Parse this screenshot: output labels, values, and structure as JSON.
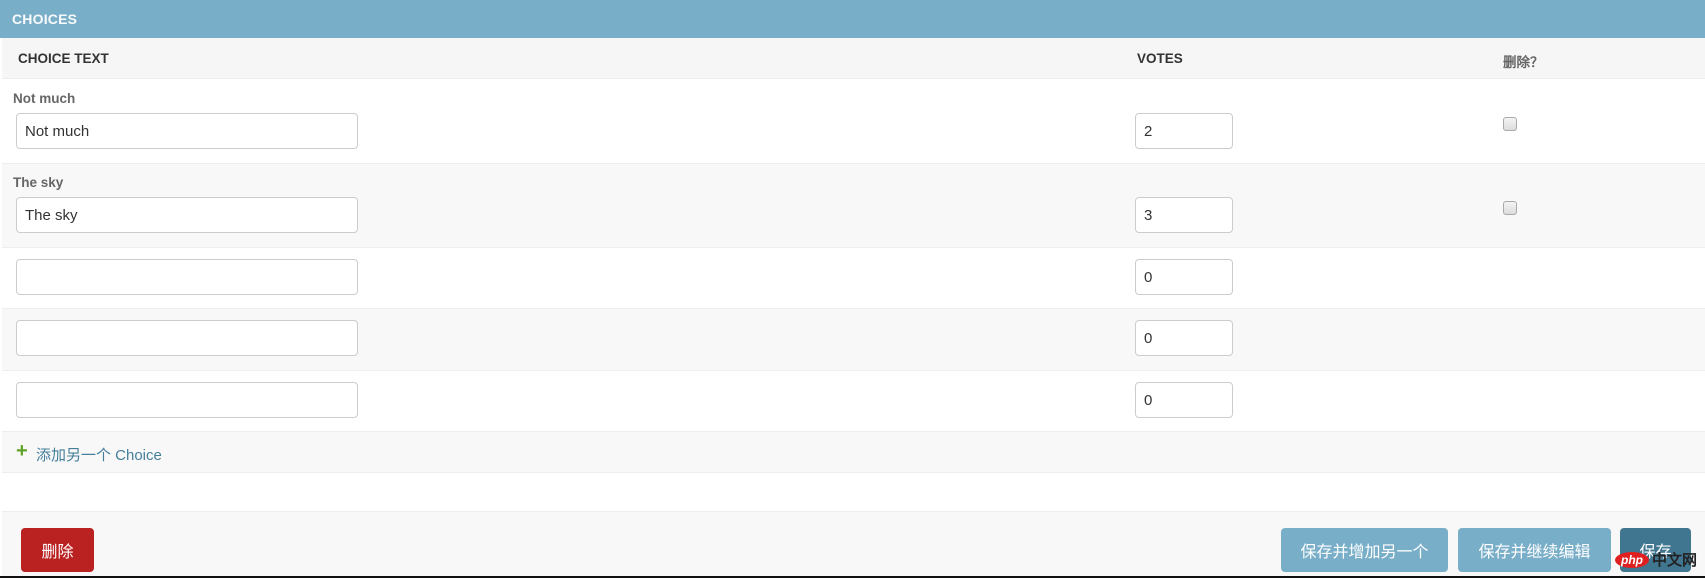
{
  "module": {
    "title": "CHOICES"
  },
  "columns": {
    "choice_text": "CHOICE TEXT",
    "votes": "VOTES",
    "delete": "删除？"
  },
  "rows": [
    {
      "label": "Not much",
      "choice_text": "Not much",
      "votes": "2",
      "deletable": true
    },
    {
      "label": "The sky",
      "choice_text": "The sky",
      "votes": "3",
      "deletable": true
    },
    {
      "label": "",
      "choice_text": "",
      "votes": "0",
      "deletable": false
    },
    {
      "label": "",
      "choice_text": "",
      "votes": "0",
      "deletable": false
    },
    {
      "label": "",
      "choice_text": "",
      "votes": "0",
      "deletable": false
    }
  ],
  "add_row": {
    "icon": "plus-icon",
    "label": "添加另一个 Choice"
  },
  "actions": {
    "delete": "删除",
    "save_add_another": "保存并增加另一个",
    "save_continue": "保存并继续编辑",
    "save": "保存"
  },
  "watermark": {
    "brand": "php",
    "site": "中文网"
  },
  "colors": {
    "header": "#79aec8",
    "delete_button": "#ba2121",
    "save_button": "#417690",
    "secondary_button": "#79aec8",
    "add_icon": "#5fa225",
    "link": "#447e9b"
  }
}
